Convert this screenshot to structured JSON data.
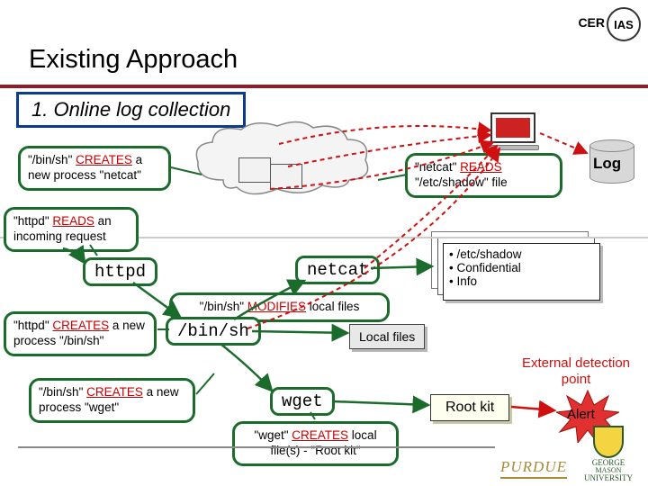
{
  "title": "Existing Approach",
  "subtitle": "1. Online log collection",
  "log_label": "Log",
  "callouts": {
    "binsh_creates_netcat": "\"/bin/sh\" CREATES a new process \"netcat\"",
    "netcat_reads_shadow": "\"netcat\" READS \"/etc/shadow\" file",
    "httpd_reads": "\"httpd\" READS an incoming request",
    "httpd_creates_binsh": "\"httpd\" CREATES a new process \"/bin/sh\"",
    "binsh_creates_wget": "\"/bin/sh\" CREATES a new process \"wget\"",
    "binsh_modifies": "\"/bin/sh\" MODIFIES local files",
    "wget_creates_rootkit": "\"wget\" CREATES local file(s) - \"Root kit\""
  },
  "nodes": {
    "httpd": "httpd",
    "binsh": "/bin/sh",
    "netcat": "netcat",
    "wget": "wget",
    "localfiles": "Local files",
    "rootkit": "Root kit"
  },
  "info": {
    "line1": "/etc/shadow",
    "line2": "Confidential",
    "line3": "Info"
  },
  "external_detection": "External detection point",
  "alert": "Alert",
  "logos": {
    "cer": "CER",
    "ias": "IAS",
    "purdue": "PURDUE",
    "gmu1": "GEORGE",
    "gmu2": "UNIVERSITY"
  }
}
